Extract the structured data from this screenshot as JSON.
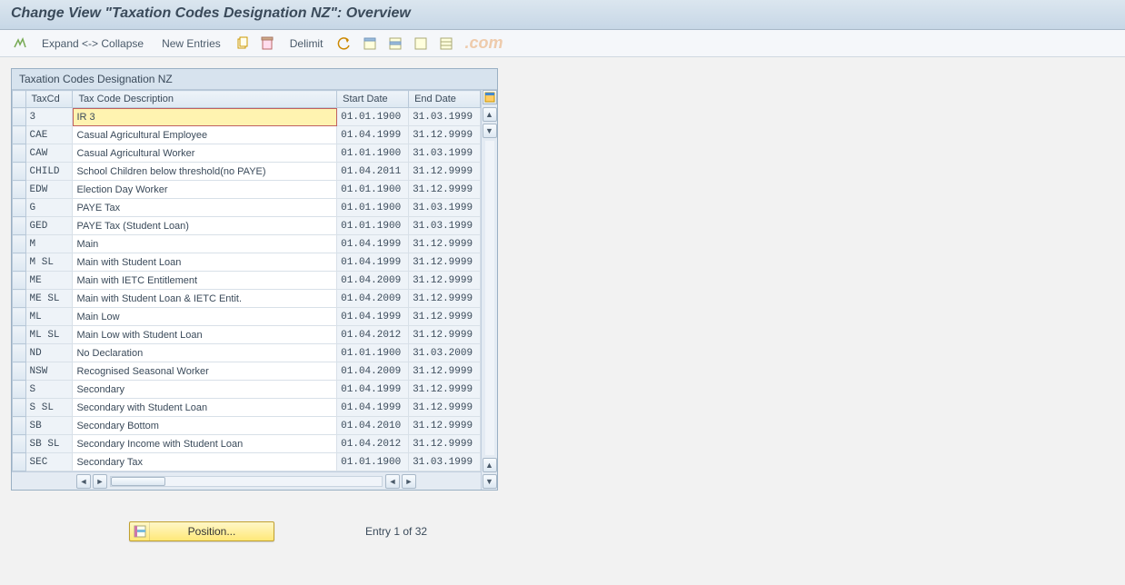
{
  "header": {
    "title": "Change View \"Taxation Codes Designation NZ\": Overview"
  },
  "toolbar": {
    "expand_collapse": "Expand <-> Collapse",
    "new_entries": "New Entries",
    "delimit": "Delimit"
  },
  "watermark": ".com",
  "panel": {
    "title": "Taxation Codes Designation NZ",
    "columns": {
      "taxcd": "TaxCd",
      "desc": "Tax Code Description",
      "start": "Start Date",
      "end": "End Date"
    },
    "rows": [
      {
        "code": "3",
        "desc": "IR 3",
        "start": "01.01.1900",
        "end": "31.03.1999",
        "selected": true
      },
      {
        "code": "CAE",
        "desc": "Casual Agricultural Employee",
        "start": "01.04.1999",
        "end": "31.12.9999"
      },
      {
        "code": "CAW",
        "desc": "Casual Agricultural Worker",
        "start": "01.01.1900",
        "end": "31.03.1999"
      },
      {
        "code": "CHILD",
        "desc": "School Children below threshold(no PAYE)",
        "start": "01.04.2011",
        "end": "31.12.9999"
      },
      {
        "code": "EDW",
        "desc": "Election Day Worker",
        "start": "01.01.1900",
        "end": "31.12.9999"
      },
      {
        "code": "G",
        "desc": "PAYE Tax",
        "start": "01.01.1900",
        "end": "31.03.1999"
      },
      {
        "code": "GED",
        "desc": "PAYE Tax (Student Loan)",
        "start": "01.01.1900",
        "end": "31.03.1999"
      },
      {
        "code": "M",
        "desc": "Main",
        "start": "01.04.1999",
        "end": "31.12.9999"
      },
      {
        "code": "M SL",
        "desc": "Main with Student Loan",
        "start": "01.04.1999",
        "end": "31.12.9999"
      },
      {
        "code": "ME",
        "desc": "Main with IETC Entitlement",
        "start": "01.04.2009",
        "end": "31.12.9999"
      },
      {
        "code": "ME SL",
        "desc": "Main with Student Loan & IETC Entit.",
        "start": "01.04.2009",
        "end": "31.12.9999"
      },
      {
        "code": "ML",
        "desc": "Main Low",
        "start": "01.04.1999",
        "end": "31.12.9999"
      },
      {
        "code": "ML SL",
        "desc": "Main Low with Student Loan",
        "start": "01.04.2012",
        "end": "31.12.9999"
      },
      {
        "code": "ND",
        "desc": "No Declaration",
        "start": "01.01.1900",
        "end": "31.03.2009"
      },
      {
        "code": "NSW",
        "desc": "Recognised Seasonal Worker",
        "start": "01.04.2009",
        "end": "31.12.9999"
      },
      {
        "code": "S",
        "desc": "Secondary",
        "start": "01.04.1999",
        "end": "31.12.9999"
      },
      {
        "code": "S SL",
        "desc": "Secondary with Student Loan",
        "start": "01.04.1999",
        "end": "31.12.9999"
      },
      {
        "code": "SB",
        "desc": "Secondary Bottom",
        "start": "01.04.2010",
        "end": "31.12.9999"
      },
      {
        "code": "SB SL",
        "desc": "Secondary Income with Student Loan",
        "start": "01.04.2012",
        "end": "31.12.9999"
      },
      {
        "code": "SEC",
        "desc": "Secondary Tax",
        "start": "01.01.1900",
        "end": "31.03.1999"
      }
    ]
  },
  "footer": {
    "position_label": "Position...",
    "entry_info": "Entry 1 of 32"
  }
}
